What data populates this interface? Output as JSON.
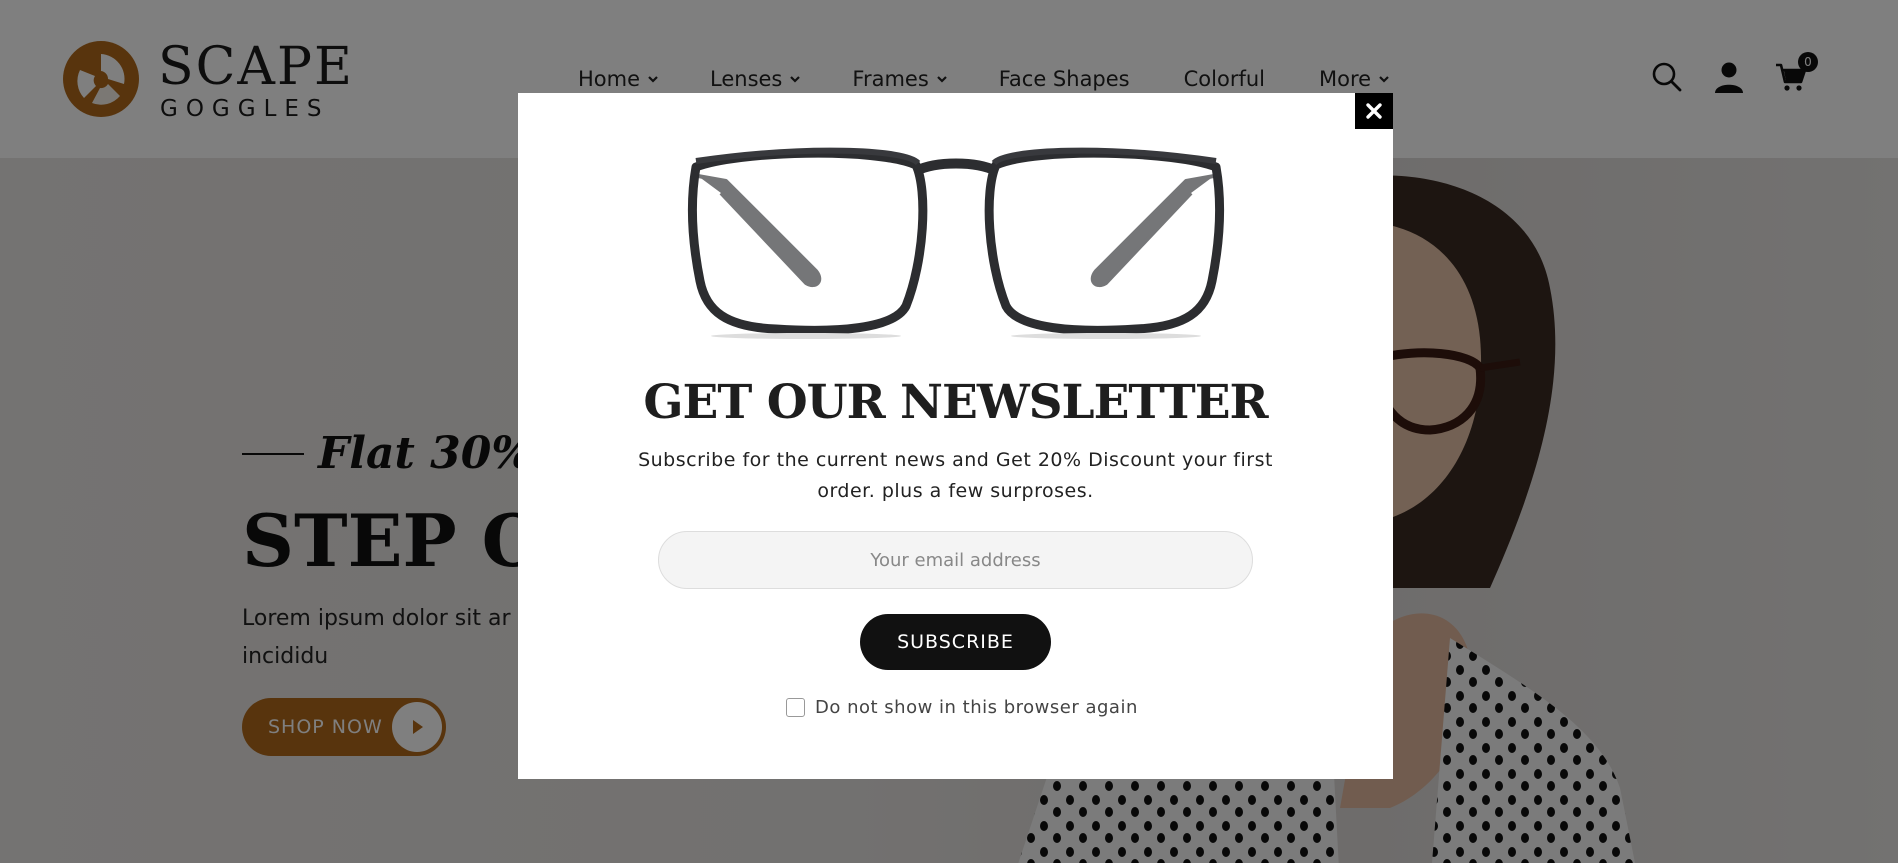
{
  "brand": {
    "name_main": "SCAPE",
    "name_sub": "GOGGLES",
    "accent_color": "#b0691a"
  },
  "nav": {
    "items": [
      {
        "label": "Home",
        "has_dropdown": true
      },
      {
        "label": "Lenses",
        "has_dropdown": true
      },
      {
        "label": "Frames",
        "has_dropdown": true
      },
      {
        "label": "Face Shapes",
        "has_dropdown": false
      },
      {
        "label": "Colorful",
        "has_dropdown": false
      },
      {
        "label": "More",
        "has_dropdown": true
      }
    ]
  },
  "header_icons": {
    "search": "search-icon",
    "account": "user-icon",
    "cart": "cart-icon",
    "cart_count": "0"
  },
  "hero": {
    "eyebrow": "Flat 30%",
    "title": "STEP OU",
    "description": "Lorem ipsum dolor sit ar eiusmod tempor incididu",
    "cta_label": "SHOP NOW"
  },
  "modal": {
    "close_icon": "close-icon",
    "title": "GET OUR NEWSLETTER",
    "subtitle": "Subscribe for the current news and Get 20% Discount your first order. plus a few surproses.",
    "email_placeholder": "Your email address",
    "subscribe_label": "SUBSCRIBE",
    "dont_show_label": "Do not show in this browser again"
  }
}
